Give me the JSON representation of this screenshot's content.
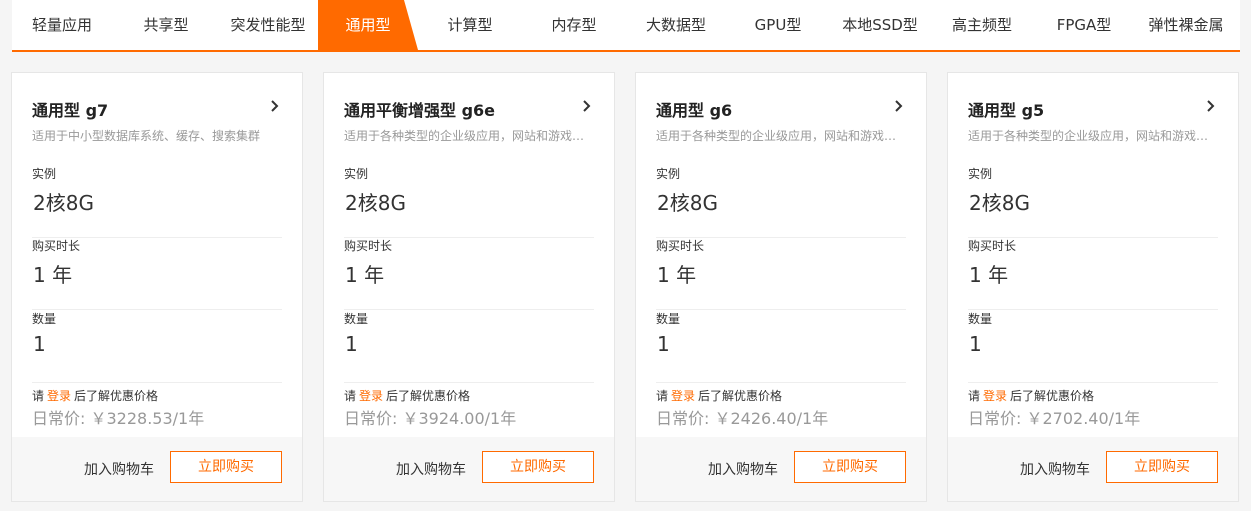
{
  "tabs": [
    {
      "label": "轻量应用"
    },
    {
      "label": "共享型"
    },
    {
      "label": "突发性能型"
    },
    {
      "label": "通用型"
    },
    {
      "label": "计算型"
    },
    {
      "label": "内存型"
    },
    {
      "label": "大数据型"
    },
    {
      "label": "GPU型"
    },
    {
      "label": "本地SSD型"
    },
    {
      "label": "高主频型"
    },
    {
      "label": "FPGA型"
    },
    {
      "label": "弹性裸金属"
    }
  ],
  "active_tab": "通用型",
  "accent_color": "#ff6a00",
  "labels": {
    "instance": "实例",
    "duration": "购买时长",
    "quantity": "数量",
    "login_prefix": "请",
    "login_link": "登录",
    "login_suffix": "后了解优惠价格",
    "add_to_cart": "加入购物车",
    "buy_now": "立即购买"
  },
  "cards": [
    {
      "title": "通用型 g7",
      "desc": "适用于中小型数据库系统、缓存、搜索集群",
      "instance": "2核8G",
      "duration": "1 年",
      "quantity": "1",
      "price": "日常价: ￥3228.53/1年"
    },
    {
      "title": "通用平衡增强型 g6e",
      "desc": "适用于各种类型的企业级应用，网站和游戏服务器",
      "instance": "2核8G",
      "duration": "1 年",
      "quantity": "1",
      "price": "日常价: ￥3924.00/1年"
    },
    {
      "title": "通用型 g6",
      "desc": "适用于各种类型的企业级应用，网站和游戏服务器",
      "instance": "2核8G",
      "duration": "1 年",
      "quantity": "1",
      "price": "日常价: ￥2426.40/1年"
    },
    {
      "title": "通用型 g5",
      "desc": "适用于各种类型的企业级应用，网站和游戏服务器",
      "instance": "2核8G",
      "duration": "1 年",
      "quantity": "1",
      "price": "日常价: ￥2702.40/1年"
    }
  ]
}
